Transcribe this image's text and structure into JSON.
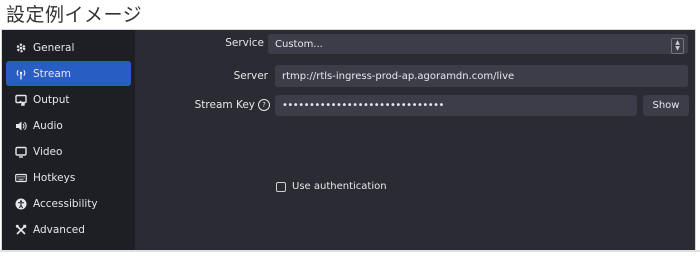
{
  "page": {
    "title": "設定例イメージ"
  },
  "sidebar": {
    "items": [
      {
        "label": "General",
        "icon": "gear-icon"
      },
      {
        "label": "Stream",
        "icon": "antenna-icon",
        "active": true
      },
      {
        "label": "Output",
        "icon": "output-icon"
      },
      {
        "label": "Audio",
        "icon": "speaker-icon"
      },
      {
        "label": "Video",
        "icon": "monitor-icon"
      },
      {
        "label": "Hotkeys",
        "icon": "keyboard-icon"
      },
      {
        "label": "Accessibility",
        "icon": "accessibility-icon"
      },
      {
        "label": "Advanced",
        "icon": "tools-icon"
      }
    ]
  },
  "stream": {
    "service_label": "Service",
    "service_value": "Custom...",
    "server_label": "Server",
    "server_value": "rtmp://rtls-ingress-prod-ap.agoramdn.com/live",
    "key_label": "Stream Key",
    "key_value": "••••••••••••••••••••••••••••••",
    "show_label": "Show",
    "auth_label": "Use authentication",
    "auth_checked": false
  },
  "colors": {
    "accent": "#285ec4",
    "window_bg": "#2b2b33",
    "sidebar_bg": "#1e1e25",
    "field_bg": "#3c3d49"
  }
}
